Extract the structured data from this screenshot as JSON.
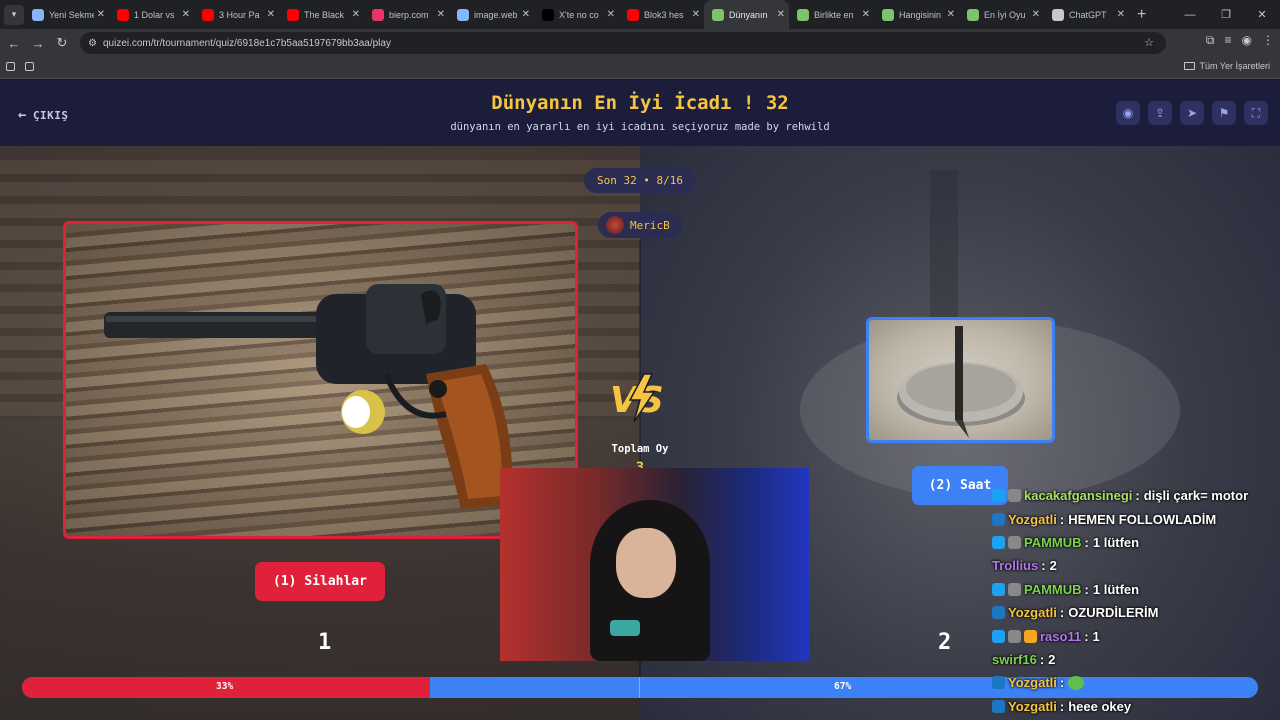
{
  "browser": {
    "tabs": [
      {
        "label": "Yeni Sekme",
        "color": "#8ab4f8",
        "active": false
      },
      {
        "label": "1 Dolar vs",
        "color": "#ff0000",
        "active": false
      },
      {
        "label": "3 Hour Pa",
        "color": "#ff0000",
        "active": false
      },
      {
        "label": "The Black",
        "color": "#ff0000",
        "active": false
      },
      {
        "label": "bierp.com",
        "color": "#e8336d",
        "active": false
      },
      {
        "label": "image.web",
        "color": "#8ab4f8",
        "active": false
      },
      {
        "label": "X'te no co",
        "color": "#000000",
        "active": false
      },
      {
        "label": "Blok3 hes",
        "color": "#ff0000",
        "active": false
      },
      {
        "label": "Dünyanın",
        "color": "#7cc36b",
        "active": true
      },
      {
        "label": "Birlikte en",
        "color": "#7cc36b",
        "active": false
      },
      {
        "label": "Hangisinin",
        "color": "#7cc36b",
        "active": false
      },
      {
        "label": "En İyi Oyu",
        "color": "#7cc36b",
        "active": false
      },
      {
        "label": "ChatGPT",
        "color": "#c8c8c8",
        "active": false
      }
    ],
    "url": "quizei.com/tr/tournament/quiz/6918e1c7b5aa5197679bb3aa/play",
    "bookmarks_label": "Tüm Yer İşaretleri"
  },
  "header": {
    "exit_label": "ÇIKIŞ",
    "title": "Dünyanın En İyi İcadı ! 32",
    "subtitle": "dünyanın en yararlı en iyi icadını seçiyoruz made by rehwild",
    "icons": [
      "eye-icon",
      "share-icon",
      "send-icon",
      "flag-icon",
      "fullscreen-icon"
    ]
  },
  "round": {
    "label": "Son 32 • 8/16",
    "user": "MericB"
  },
  "match": {
    "option1_label": "(1) Silahlar",
    "option2_label": "(2) Saat",
    "total_votes_label": "Toplam Oy",
    "total_votes_value": "3",
    "number1": "1",
    "number2": "2",
    "percent1_text": "33%",
    "percent2_text": "67%",
    "percent1": 33,
    "accent_red": "#e0213a",
    "accent_blue": "#3c82f6",
    "accent_gold": "#f5c542"
  },
  "chat": [
    {
      "user": "kacakafgansinegi",
      "text": "dişli çark= motor",
      "color": "#a8e063",
      "badges": [
        "#1da1f2",
        "#888888"
      ]
    },
    {
      "user": "Yozgatli",
      "text": "HEMEN FOLLOWLADİM",
      "color": "#f5c542",
      "badges": [
        "#1d76c2"
      ]
    },
    {
      "user": "PAMMUB",
      "text": "1 lütfen",
      "color": "#7cd44e",
      "badges": [
        "#1da1f2",
        "#888888"
      ]
    },
    {
      "user": "Trollius",
      "text": "2",
      "color": "#b277e8",
      "badges": []
    },
    {
      "user": "PAMMUB",
      "text": "1 lütfen",
      "color": "#7cd44e",
      "badges": [
        "#1da1f2",
        "#888888"
      ]
    },
    {
      "user": "Yozgatli",
      "text": "OZURDİLERİM",
      "color": "#f5c542",
      "badges": [
        "#1d76c2"
      ]
    },
    {
      "user": "raso11",
      "text": "1",
      "color": "#b277e8",
      "badges": [
        "#1da1f2",
        "#888888",
        "#f5a623"
      ]
    },
    {
      "user": "swirf16",
      "text": "2",
      "color": "#7cd44e",
      "badges": []
    },
    {
      "user": "Yozgatli",
      "text": "",
      "color": "#f5c542",
      "badges": [
        "#1d76c2"
      ]
    },
    {
      "user": "Yozgatli",
      "text": "heee okey",
      "color": "#f5c542",
      "badges": [
        "#1d76c2"
      ]
    }
  ]
}
